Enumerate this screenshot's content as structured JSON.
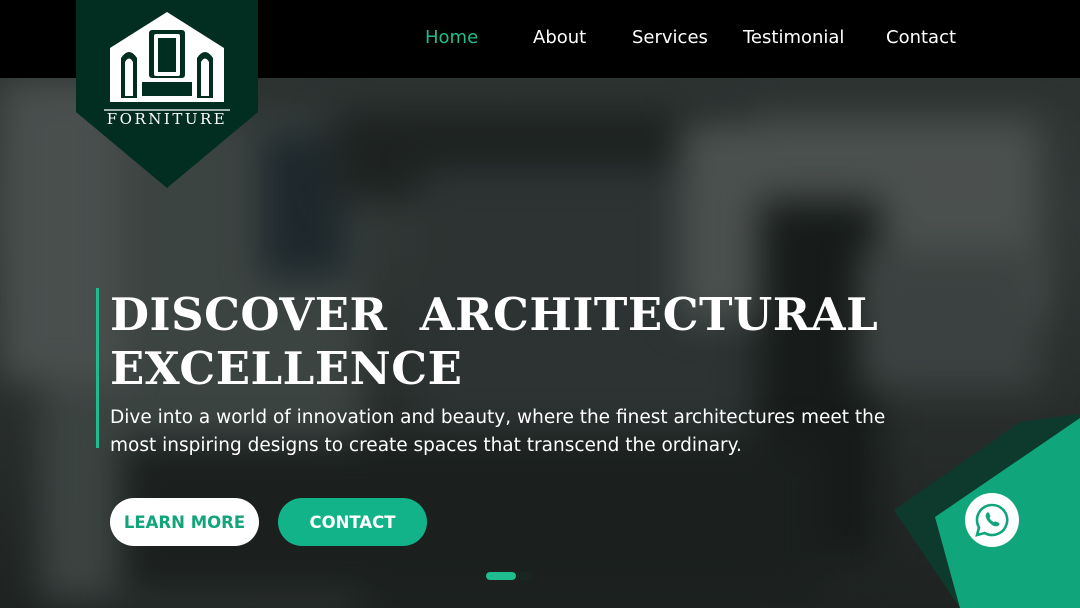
{
  "brand": {
    "logo_text": "FORNITURE"
  },
  "nav": {
    "items": [
      {
        "label": "Home",
        "active": true
      },
      {
        "label": "About",
        "active": false
      },
      {
        "label": "Services",
        "active": false
      },
      {
        "label": "Testimonial",
        "active": false
      },
      {
        "label": "Contact",
        "active": false
      }
    ]
  },
  "hero": {
    "title_line1": "DISCOVER  ARCHITECTURAL",
    "title_line2": "EXCELLENCE",
    "subtitle": "Dive into a world of innovation and beauty, where the finest architectures meet the most inspiring designs to create spaces that transcend the ordinary.",
    "learn_more_label": "LEARN MORE",
    "contact_label": "CONTACT"
  },
  "slider": {
    "slide_count": 2,
    "active_slide": 1
  },
  "colors": {
    "accent": "#1fbd8e",
    "logo_bg": "#022e22",
    "navbar": "#000000"
  },
  "icons": {
    "whatsapp": "whatsapp-icon"
  }
}
